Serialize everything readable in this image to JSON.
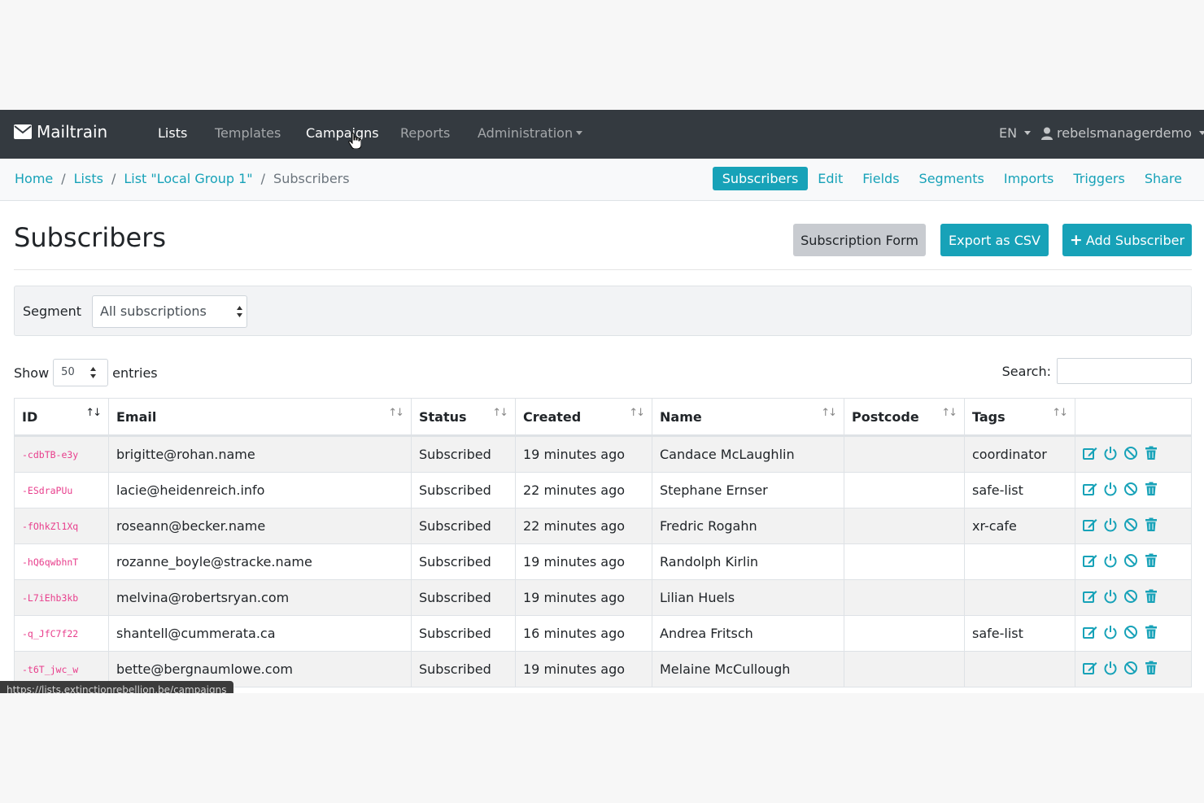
{
  "brand": {
    "name": "Mailtrain"
  },
  "nav": {
    "items": [
      {
        "label": "Lists",
        "active": true
      },
      {
        "label": "Templates",
        "active": false
      },
      {
        "label": "Campaigns",
        "active": false
      },
      {
        "label": "Reports",
        "active": false
      },
      {
        "label": "Administration",
        "active": false
      }
    ],
    "lang": "EN",
    "user": "rebelsmanagerdemo"
  },
  "breadcrumb": {
    "home": "Home",
    "lists": "Lists",
    "list": "List \"Local Group 1\"",
    "current": "Subscribers"
  },
  "subnav": [
    "Subscribers",
    "Edit",
    "Fields",
    "Segments",
    "Imports",
    "Triggers",
    "Share"
  ],
  "page": {
    "title": "Subscribers",
    "subscription_form_label": "Subscription Form",
    "export_label": "Export as CSV",
    "add_label": "Add Subscriber"
  },
  "segment": {
    "label": "Segment",
    "value": "All subscriptions"
  },
  "entries": {
    "show": "Show",
    "value": "50",
    "entries": "entries",
    "search_label": "Search:",
    "search_value": ""
  },
  "table": {
    "columns": [
      "ID",
      "Email",
      "Status",
      "Created",
      "Name",
      "Postcode",
      "Tags"
    ],
    "rows": [
      {
        "id": "-cdbTB-e3y",
        "email": "brigitte@rohan.name",
        "status": "Subscribed",
        "created": "19 minutes ago",
        "name": "Candace McLaughlin",
        "postcode": "",
        "tags": "coordinator"
      },
      {
        "id": "-ESdraPUu",
        "email": "lacie@heidenreich.info",
        "status": "Subscribed",
        "created": "22 minutes ago",
        "name": "Stephane Ernser",
        "postcode": "",
        "tags": "safe-list"
      },
      {
        "id": "-fOhkZl1Xq",
        "email": "roseann@becker.name",
        "status": "Subscribed",
        "created": "22 minutes ago",
        "name": "Fredric Rogahn",
        "postcode": "",
        "tags": "xr-cafe"
      },
      {
        "id": "-hQ6qwbhnT",
        "email": "rozanne_boyle@stracke.name",
        "status": "Subscribed",
        "created": "19 minutes ago",
        "name": "Randolph Kirlin",
        "postcode": "",
        "tags": ""
      },
      {
        "id": "-L7iEhb3kb",
        "email": "melvina@robertsryan.com",
        "status": "Subscribed",
        "created": "19 minutes ago",
        "name": "Lilian Huels",
        "postcode": "",
        "tags": ""
      },
      {
        "id": "-q_JfC7f22",
        "email": "shantell@cummerata.ca",
        "status": "Subscribed",
        "created": "16 minutes ago",
        "name": "Andrea Fritsch",
        "postcode": "",
        "tags": "safe-list"
      },
      {
        "id": "-t6T_jwc_w",
        "email": "bette@bergnaumlowe.com",
        "status": "Subscribed",
        "created": "19 minutes ago",
        "name": "Melaine McCullough",
        "postcode": "",
        "tags": ""
      }
    ]
  },
  "statusbar": "https://lists.extinctionrebellion.be/campaigns",
  "colors": {
    "navbar": "#343a40",
    "accent": "#17a2b8",
    "id_text": "#e83e8c"
  }
}
